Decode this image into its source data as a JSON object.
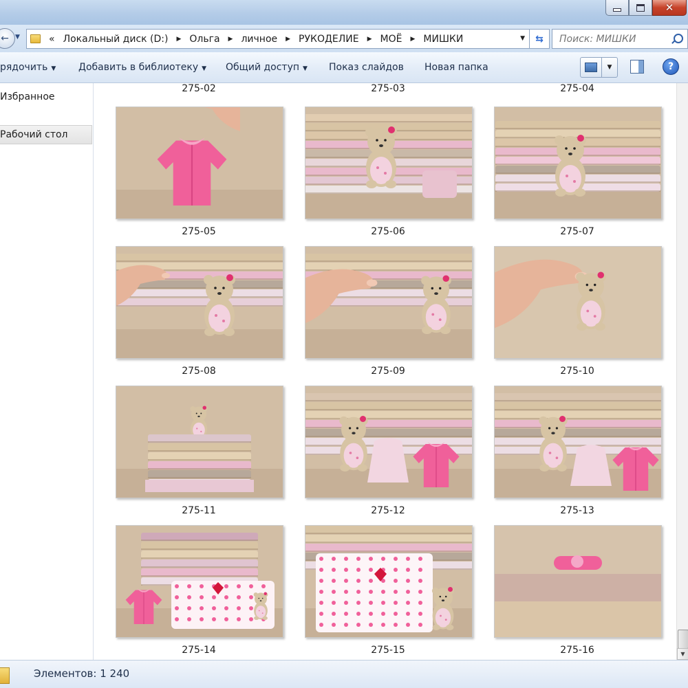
{
  "window": {
    "title_fragment": "..."
  },
  "address": {
    "overflow": "«",
    "crumbs": [
      "Локальный диск (D:)",
      "Ольга",
      "личное",
      "РУКОДЕЛИЕ",
      "МОЁ",
      "МИШКИ"
    ]
  },
  "search": {
    "placeholder": "Поиск: МИШКИ"
  },
  "toolbar": {
    "organize": "рядочить",
    "add_library": "Добавить в библиотеку",
    "share": "Общий доступ",
    "slideshow": "Показ слайдов",
    "new_folder": "Новая папка"
  },
  "nav": {
    "favorites": "Избранное",
    "desktop": "Рабочий стол"
  },
  "files": {
    "top_labels": [
      "275-02",
      "275-03",
      "275-04"
    ],
    "items": [
      {
        "name": "275-05",
        "scene": "cardigan"
      },
      {
        "name": "275-06",
        "scene": "bear-standing"
      },
      {
        "name": "275-07",
        "scene": "bear-sitting"
      },
      {
        "name": "275-08",
        "scene": "finger-left"
      },
      {
        "name": "275-09",
        "scene": "hand-left"
      },
      {
        "name": "275-10",
        "scene": "hand-hold"
      },
      {
        "name": "275-11",
        "scene": "bear-on-stack"
      },
      {
        "name": "275-12",
        "scene": "bear-dress-cardigan"
      },
      {
        "name": "275-13",
        "scene": "bear-dress-cardigan-2"
      },
      {
        "name": "275-14",
        "scene": "bear-in-bed"
      },
      {
        "name": "275-15",
        "scene": "pillow-closeup"
      },
      {
        "name": "275-16",
        "scene": "headband"
      }
    ]
  },
  "status": {
    "count": "Элементов: 1 240"
  },
  "colors": {
    "titlebar": "#b4cce8",
    "toolbar": "#e4edf8",
    "fabric_beige": "#d8c4a4",
    "fabric_pink": "#e9b9cc",
    "bear": "#d7c4a4",
    "knit_pink": "#f0609a"
  }
}
